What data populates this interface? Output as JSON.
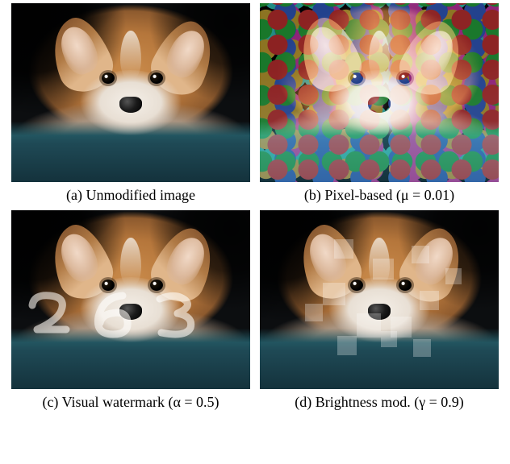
{
  "panels": [
    {
      "label": "(a) Unmodified image"
    },
    {
      "label": "(b) Pixel-based (μ = 0.01)"
    },
    {
      "label": "(c) Visual watermark (α = 0.5)"
    },
    {
      "label": "(d) Brightness mod. (γ = 0.9)"
    }
  ],
  "watermark_digits": "263"
}
